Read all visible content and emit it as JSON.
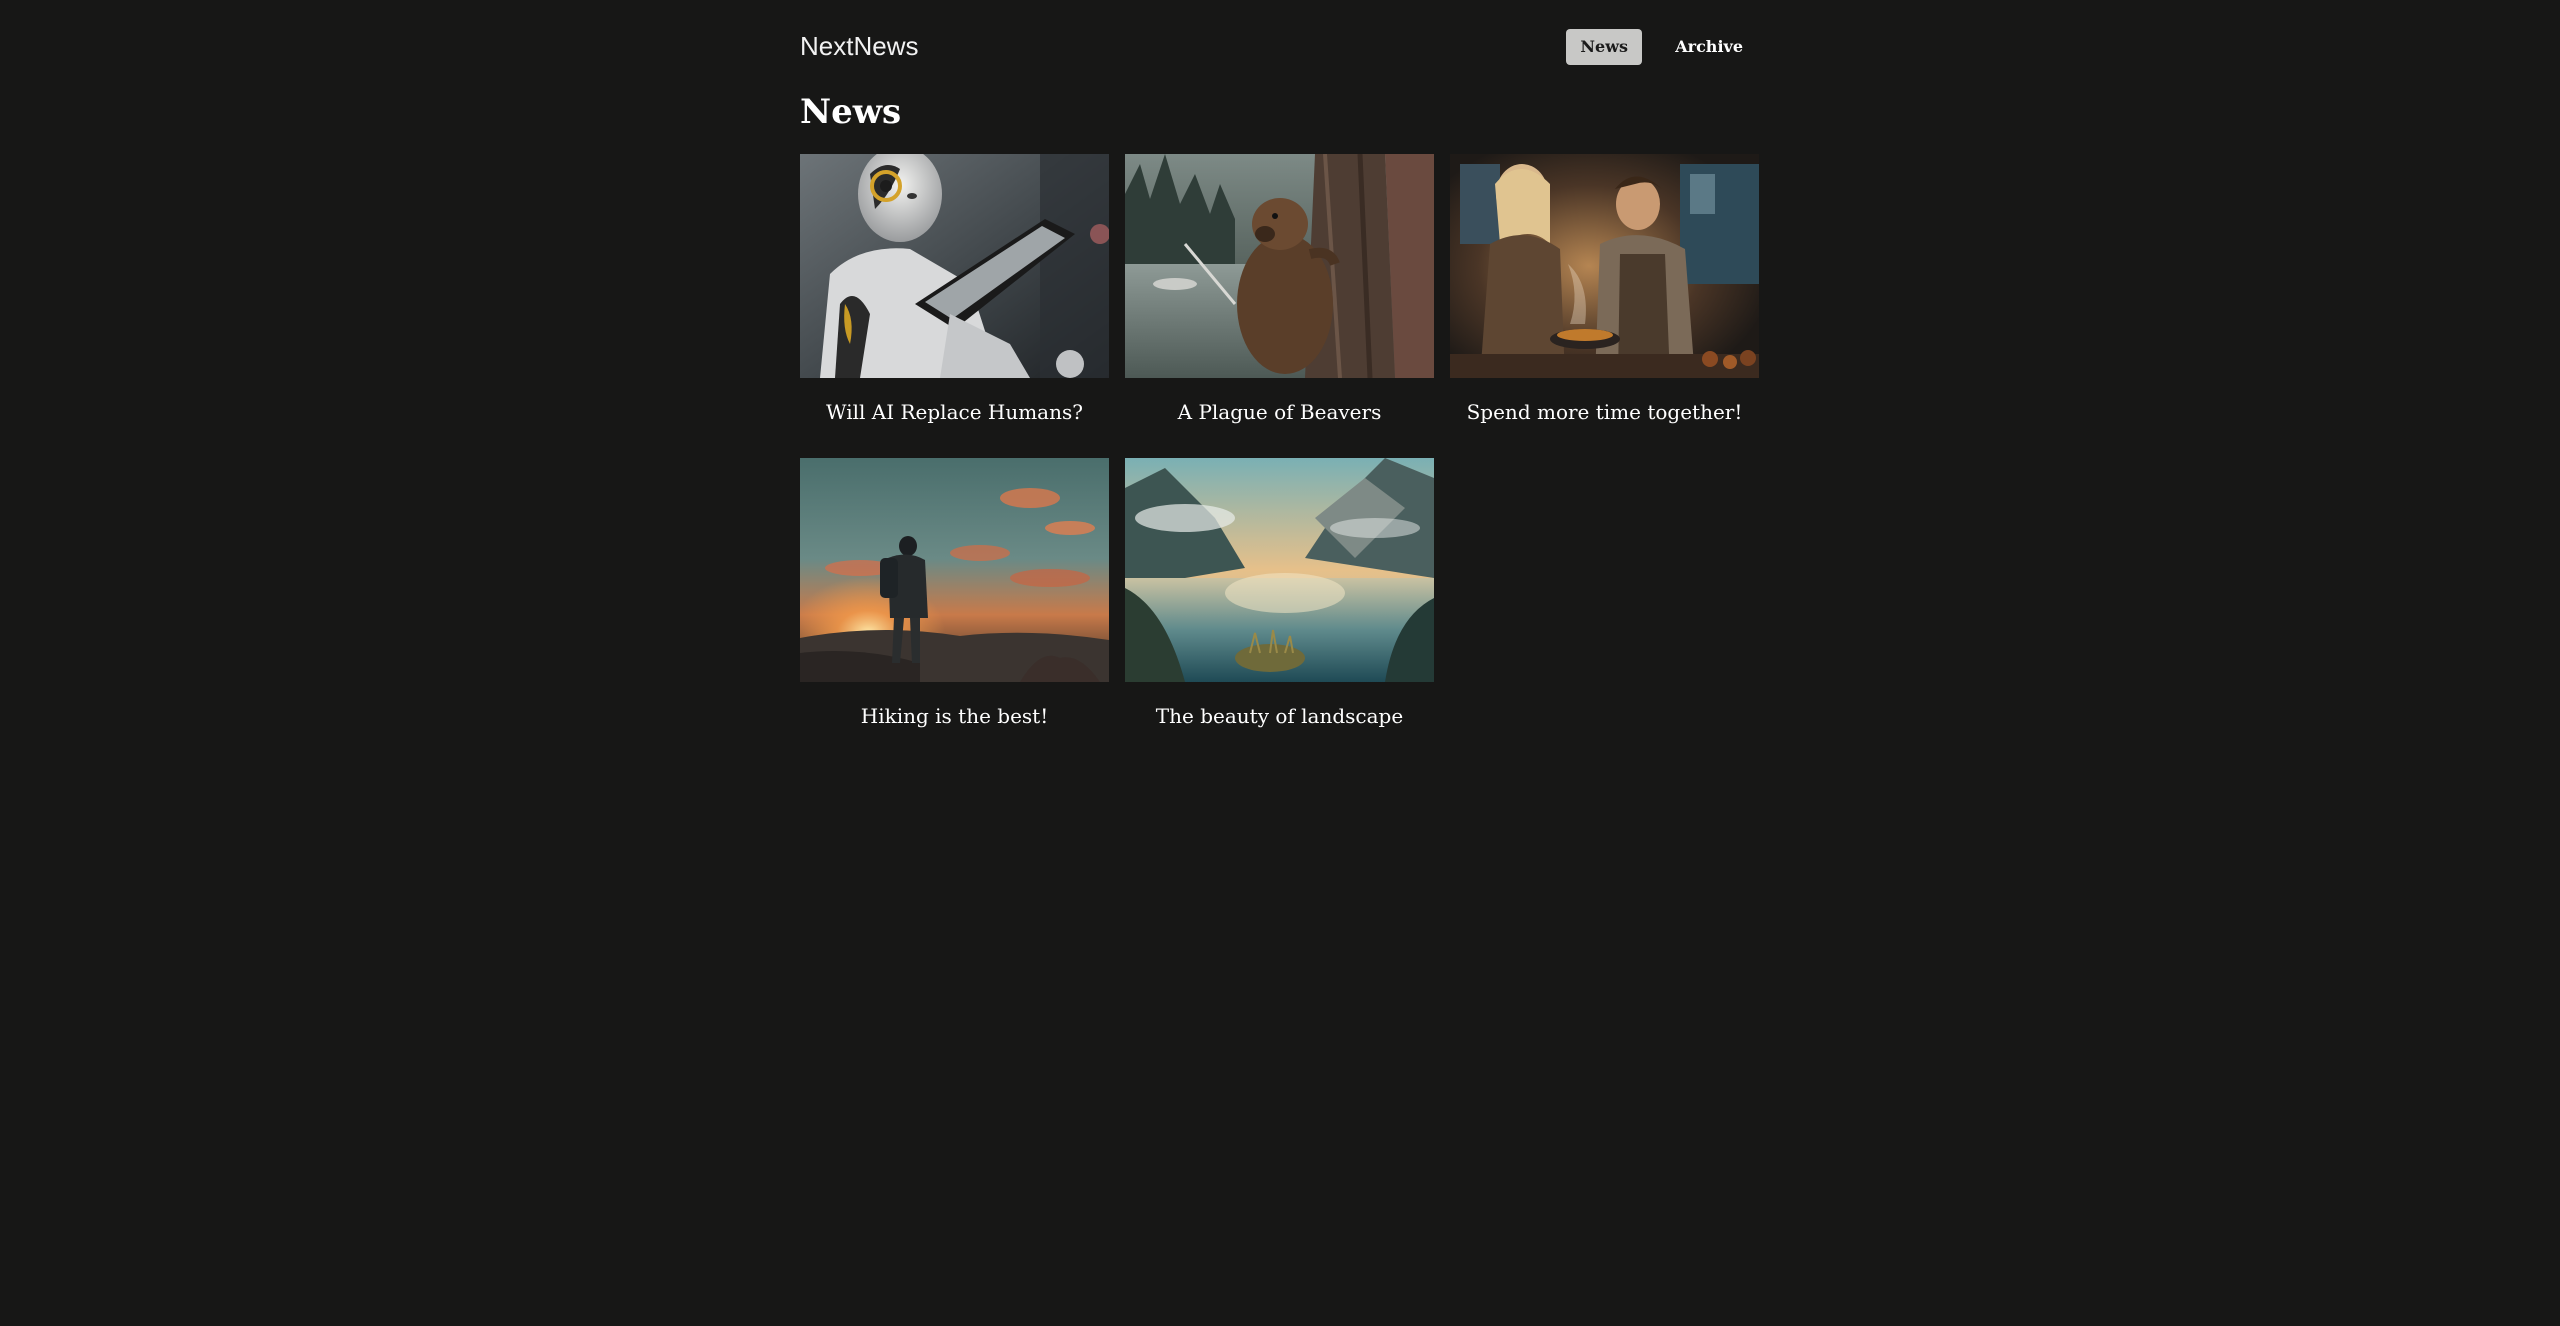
{
  "site": {
    "brand": "NextNews"
  },
  "nav": {
    "items": [
      {
        "label": "News",
        "active": true
      },
      {
        "label": "Archive",
        "active": false
      }
    ]
  },
  "page": {
    "title": "News"
  },
  "articles": [
    {
      "title": "Will AI Replace Humans?",
      "image": "robot-reading-tablet-image"
    },
    {
      "title": "A Plague of Beavers",
      "image": "beaver-on-tree-image"
    },
    {
      "title": "Spend more time together!",
      "image": "couple-cooking-image"
    },
    {
      "title": "Hiking is the best!",
      "image": "hiker-at-sunset-image"
    },
    {
      "title": "The beauty of landscape",
      "image": "mountain-lake-image"
    }
  ],
  "colors": {
    "background": "#171716",
    "nav_active_bg": "#c8c8c6",
    "text": "#ffffff"
  }
}
